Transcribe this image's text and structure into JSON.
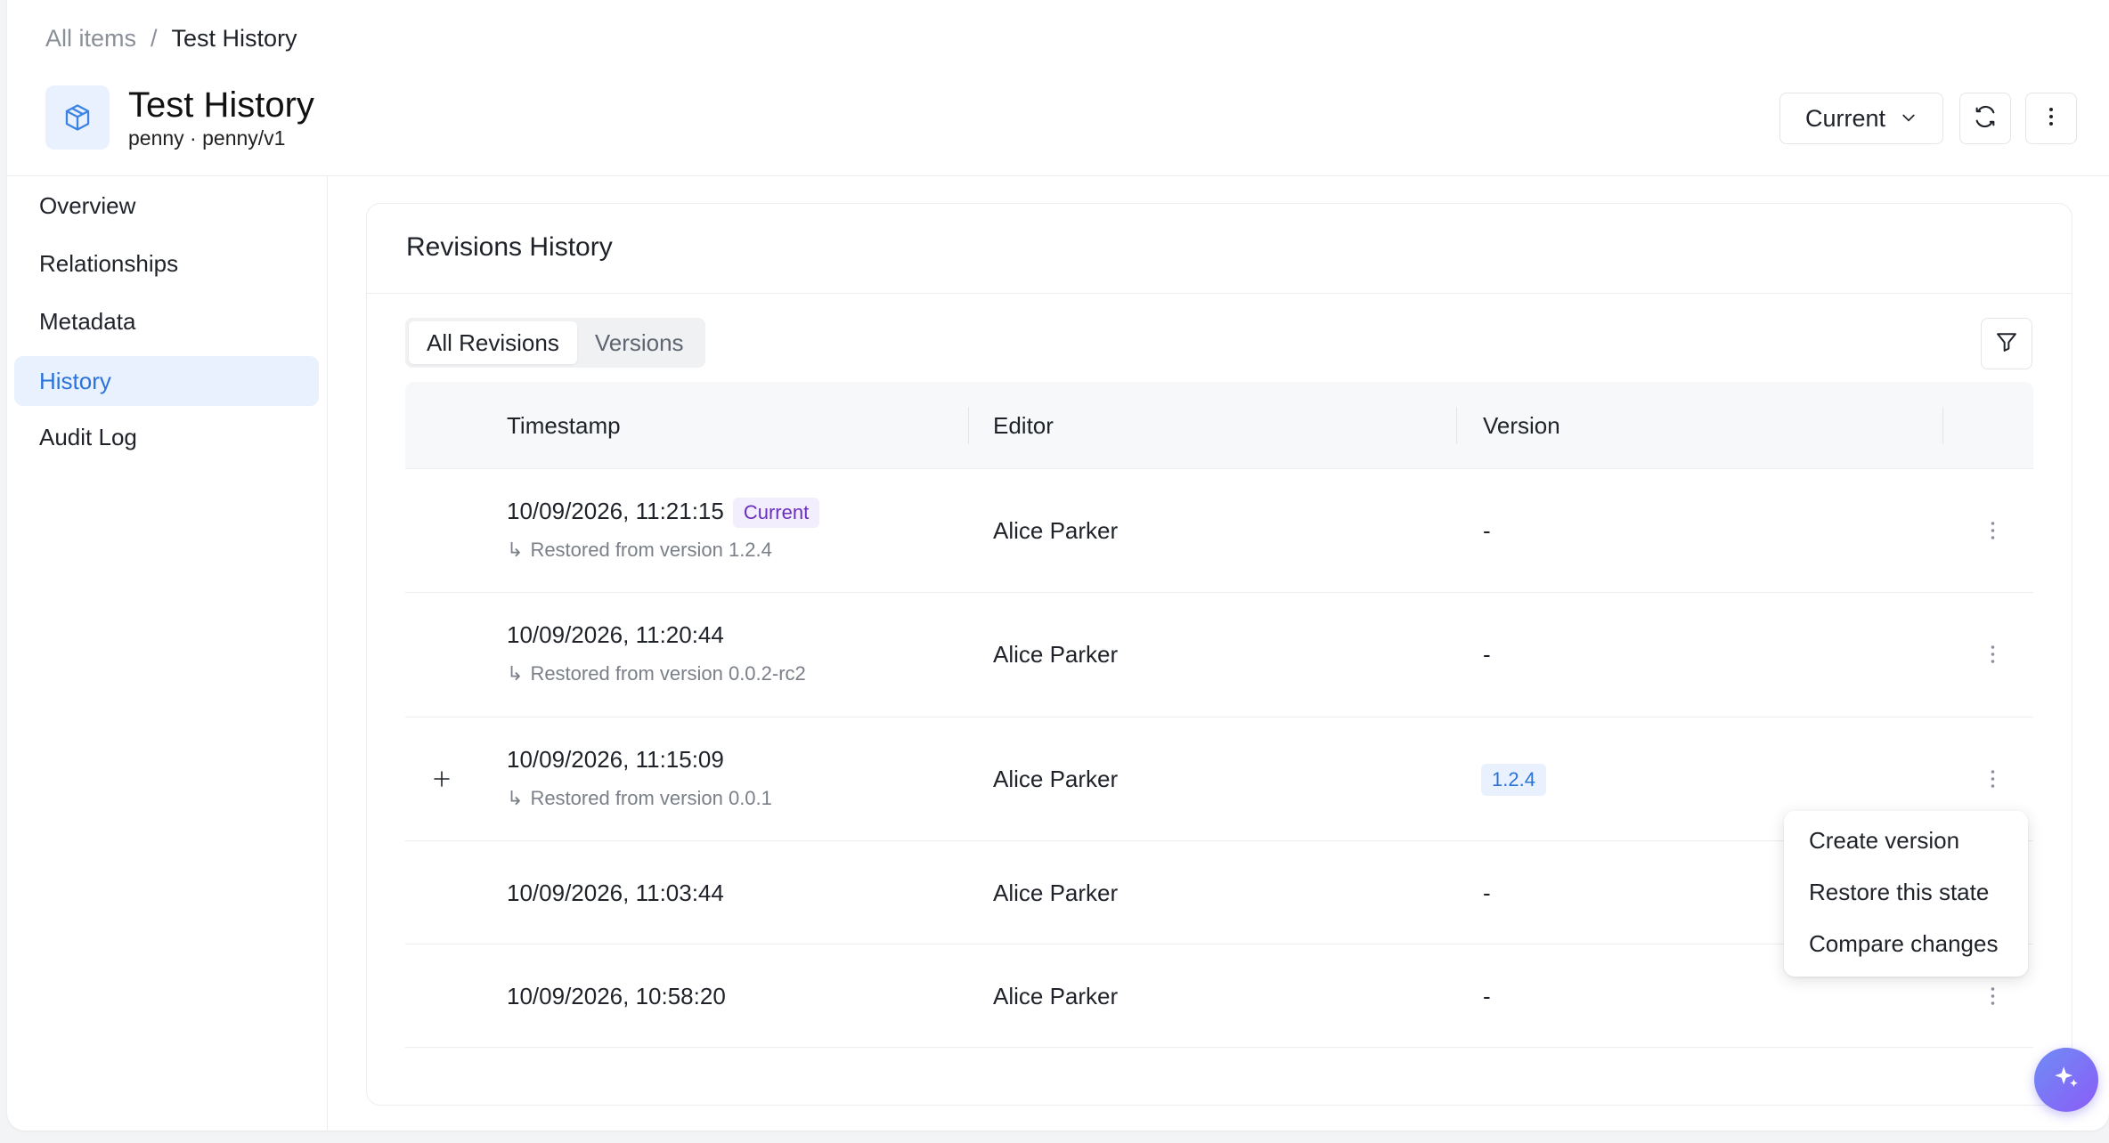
{
  "breadcrumb": {
    "root": "All items",
    "separator": "/",
    "current": "Test History"
  },
  "header": {
    "title": "Test History",
    "subtitle": "penny · penny/v1",
    "version_select": "Current",
    "icons": {
      "item": "cube-icon",
      "refresh": "refresh-icon",
      "more": "kebab-icon"
    }
  },
  "sidebar": {
    "items": [
      {
        "label": "Overview"
      },
      {
        "label": "Relationships"
      },
      {
        "label": "Metadata"
      },
      {
        "label": "History",
        "active": true
      },
      {
        "label": "Audit Log"
      }
    ]
  },
  "card": {
    "title": "Revisions History",
    "tabs": [
      {
        "label": "All Revisions",
        "active": true
      },
      {
        "label": "Versions"
      }
    ]
  },
  "table": {
    "columns": [
      "Timestamp",
      "Editor",
      "Version"
    ],
    "rows": [
      {
        "timestamp": "10/09/2026, 11:21:15",
        "badge": "Current",
        "restored": "Restored from version 1.2.4",
        "editor": "Alice Parker",
        "version": "-"
      },
      {
        "timestamp": "10/09/2026, 11:20:44",
        "restored": "Restored from version 0.0.2-rc2",
        "editor": "Alice Parker",
        "version": "-"
      },
      {
        "timestamp": "10/09/2026, 11:15:09",
        "restored": "Restored from version 0.0.1",
        "editor": "Alice Parker",
        "version": "1.2.4",
        "expandable": true
      },
      {
        "timestamp": "10/09/2026, 11:03:44",
        "editor": "Alice Parker",
        "version": "-"
      },
      {
        "timestamp": "10/09/2026, 10:58:20",
        "editor": "Alice Parker",
        "version": "-"
      }
    ]
  },
  "context_menu": {
    "items": [
      "Create version",
      "Restore this state",
      "Compare changes"
    ]
  },
  "colors": {
    "accent": "#2a73d9",
    "current_badge": "#6b2fc0",
    "fab_start": "#6f8cf5",
    "fab_end": "#8b5cf6"
  }
}
